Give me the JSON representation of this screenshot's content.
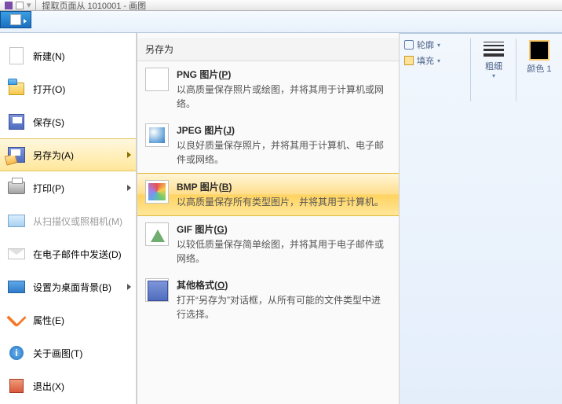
{
  "window": {
    "title": "提取页面从 1010001 - 画图"
  },
  "file_menu": {
    "items": [
      {
        "label": "新建(N)",
        "icon": "new"
      },
      {
        "label": "打开(O)",
        "icon": "open"
      },
      {
        "label": "保存(S)",
        "icon": "save"
      },
      {
        "label": "另存为(A)",
        "icon": "saveas",
        "arrow": true,
        "hover": true
      },
      {
        "label": "打印(P)",
        "icon": "print",
        "arrow": true
      },
      {
        "label": "从扫描仪或照相机(M)",
        "icon": "scan",
        "disabled": true
      },
      {
        "label": "在电子邮件中发送(D)",
        "icon": "mail"
      },
      {
        "label": "设置为桌面背景(B)",
        "icon": "bg",
        "arrow": true
      },
      {
        "label": "属性(E)",
        "icon": "prop"
      },
      {
        "label": "关于画图(T)",
        "icon": "about"
      },
      {
        "label": "退出(X)",
        "icon": "exit"
      }
    ]
  },
  "saveas": {
    "title": "另存为",
    "items": [
      {
        "label_pre": "PNG 图片(",
        "hotkey": "P",
        "label_post": ")",
        "desc": "以高质量保存照片或绘图，并将其用于计算机或网络。"
      },
      {
        "label_pre": "JPEG 图片(",
        "hotkey": "J",
        "label_post": ")",
        "desc": "以良好质量保存照片，并将其用于计算机、电子邮件或网络。"
      },
      {
        "label_pre": "BMP 图片(",
        "hotkey": "B",
        "label_post": ")",
        "desc": "以高质量保存所有类型图片，并将其用于计算机。",
        "highlight": true
      },
      {
        "label_pre": "GIF 图片(",
        "hotkey": "G",
        "label_post": ")",
        "desc": "以较低质量保存简单绘图，并将其用于电子邮件或网络。"
      },
      {
        "label_pre": "其他格式(",
        "hotkey": "O",
        "label_post": ")",
        "desc": "打开“另存为”对话框，从所有可能的文件类型中进行选择。"
      }
    ]
  },
  "ribbon": {
    "outline": "轮廓",
    "fill": "填充",
    "thickness": "粗细",
    "color1": "颜色 1"
  }
}
